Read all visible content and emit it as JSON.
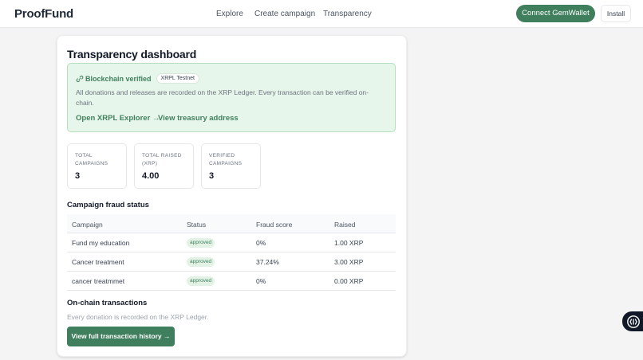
{
  "header": {
    "brand": "ProofFund",
    "nav": [
      "Explore",
      "Create campaign",
      "Transparency"
    ],
    "connect_label": "Connect GemWallet",
    "install_label": "Install"
  },
  "page": {
    "title": "Transparency dashboard"
  },
  "verification": {
    "title": "Blockchain verified",
    "network_badge": "XRPL Testnet",
    "description": "All donations and releases are recorded on the XRP Ledger. Every transaction can be verified on-chain.",
    "explorer_link": "Open XRPL Explorer →",
    "treasury_link": "View treasury address"
  },
  "stats": [
    {
      "label": "TOTAL CAMPAIGNS",
      "value": "3"
    },
    {
      "label": "TOTAL RAISED (XRP)",
      "value": "4.00"
    },
    {
      "label": "VERIFIED CAMPAIGNS",
      "value": "3"
    }
  ],
  "fraud_section": {
    "title": "Campaign fraud status",
    "columns": [
      "Campaign",
      "Status",
      "Fraud score",
      "Raised"
    ],
    "rows": [
      {
        "campaign": "Fund my education",
        "status": "approved",
        "fraud_score": "0%",
        "raised": "1.00 XRP"
      },
      {
        "campaign": "Cancer treatment",
        "status": "approved",
        "fraud_score": "37.24%",
        "raised": "3.00 XRP"
      },
      {
        "campaign": "cancer treatmmet",
        "status": "approved",
        "fraud_score": "0%",
        "raised": "0.00 XRP"
      }
    ]
  },
  "onchain": {
    "title": "On-chain transactions",
    "note": "Every donation is recorded on the XRP Ledger.",
    "history_button": "View full transaction history →"
  },
  "colors": {
    "accent": "#3f7f5d",
    "verify_bg": "#e7f6ea",
    "page_bg": "#f4f4f5"
  },
  "icons": {
    "verified": "link-icon",
    "widget": "accessibility-icon"
  }
}
